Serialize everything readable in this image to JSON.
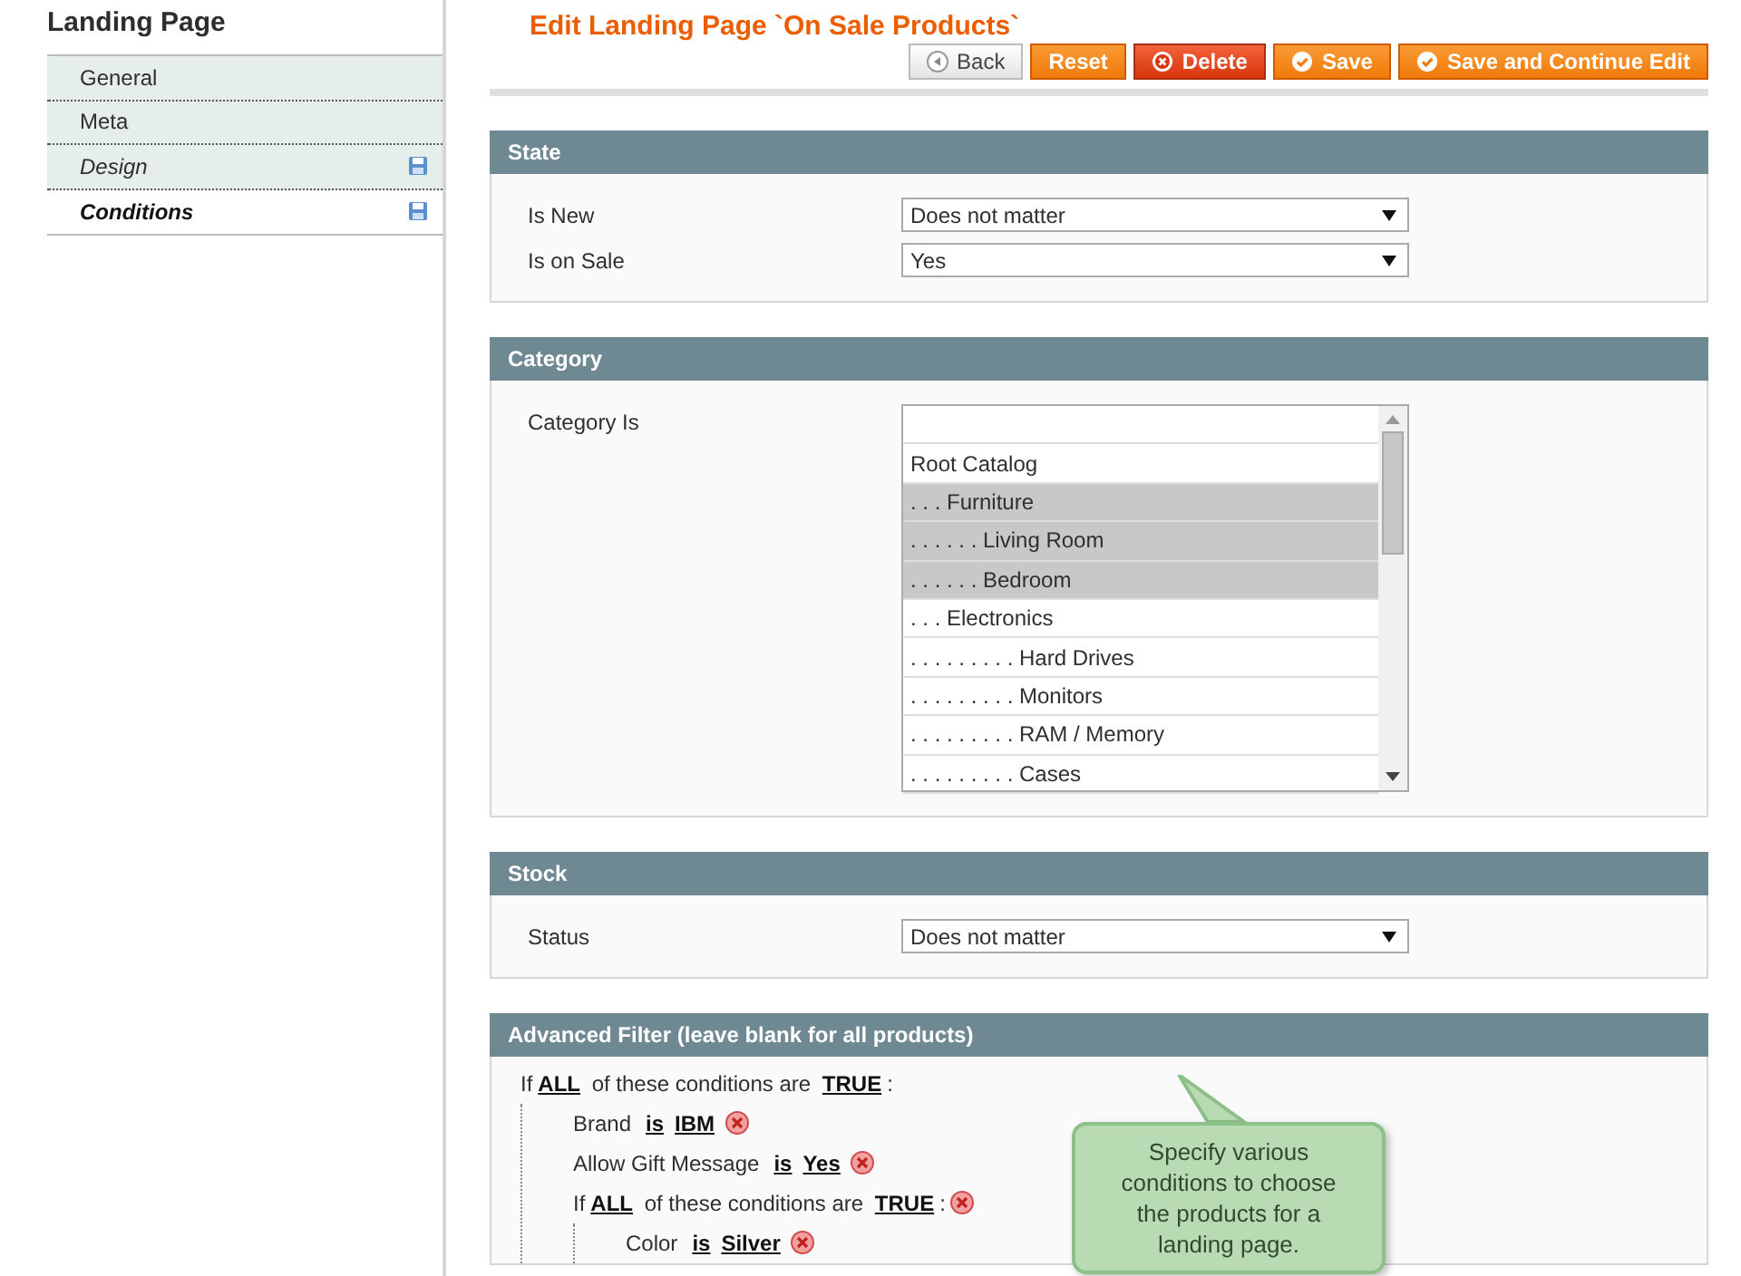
{
  "sidebar": {
    "title": "Landing Page",
    "items": [
      {
        "label": "General",
        "changed": false,
        "selected": false
      },
      {
        "label": "Meta",
        "changed": false,
        "selected": false
      },
      {
        "label": "Design",
        "changed": true,
        "selected": false
      },
      {
        "label": "Conditions",
        "changed": true,
        "selected": true
      }
    ]
  },
  "page_title": "Edit Landing Page `On Sale Products`",
  "buttons": [
    {
      "label": "Back",
      "kind": "back"
    },
    {
      "label": "Reset",
      "kind": "plain"
    },
    {
      "label": "Delete",
      "kind": "delete"
    },
    {
      "label": "Save",
      "kind": "save"
    },
    {
      "label": "Save and Continue Edit",
      "kind": "save"
    }
  ],
  "sections": [
    {
      "title": "State",
      "fields": [
        {
          "label": "Is New",
          "kind": "select",
          "value": "Does not matter"
        },
        {
          "label": "Is on Sale",
          "kind": "select",
          "value": "Yes"
        }
      ]
    },
    {
      "title": "Category",
      "fields": [
        {
          "label": "Category Is",
          "kind": "multiselect",
          "options": [
            {
              "label": "Root Catalog",
              "selected": false
            },
            {
              "label": ". . . Furniture",
              "selected": true
            },
            {
              "label": ". . . . . . Living Room",
              "selected": true
            },
            {
              "label": ". . . . . . Bedroom",
              "selected": true
            },
            {
              "label": ". . . Electronics",
              "selected": false
            },
            {
              "label": ". . . . . . . . . Hard Drives",
              "selected": false
            },
            {
              "label": ". . . . . . . . . Monitors",
              "selected": false
            },
            {
              "label": ". . . . . . . . . RAM / Memory",
              "selected": false
            },
            {
              "label": ". . . . . . . . . Cases",
              "selected": false
            }
          ]
        }
      ]
    },
    {
      "title": "Stock",
      "fields": [
        {
          "label": "Status",
          "kind": "select",
          "value": "Does not matter"
        }
      ]
    },
    {
      "title": "Advanced Filter (leave blank for all products)",
      "conditions": [
        {
          "kind": "group",
          "prefix": "If",
          "aggregator": "ALL",
          "middle": "of these conditions are",
          "value": "TRUE",
          "suffix": ":",
          "removable": false,
          "children": [
            {
              "kind": "rule",
              "attribute": "Brand",
              "operator": "is",
              "value": "IBM",
              "removable": true
            },
            {
              "kind": "rule",
              "attribute": "Allow Gift Message",
              "operator": "is",
              "value": "Yes",
              "removable": true
            },
            {
              "kind": "group",
              "prefix": "If",
              "aggregator": "ALL",
              "middle": "of these conditions are",
              "value": "TRUE",
              "suffix": ":",
              "removable": true,
              "children": [
                {
                  "kind": "rule",
                  "attribute": "Color",
                  "operator": "is",
                  "value": "Silver",
                  "removable": true
                }
              ]
            }
          ]
        }
      ]
    }
  ],
  "tooltip": "Specify various conditions to choose the products for a landing page."
}
